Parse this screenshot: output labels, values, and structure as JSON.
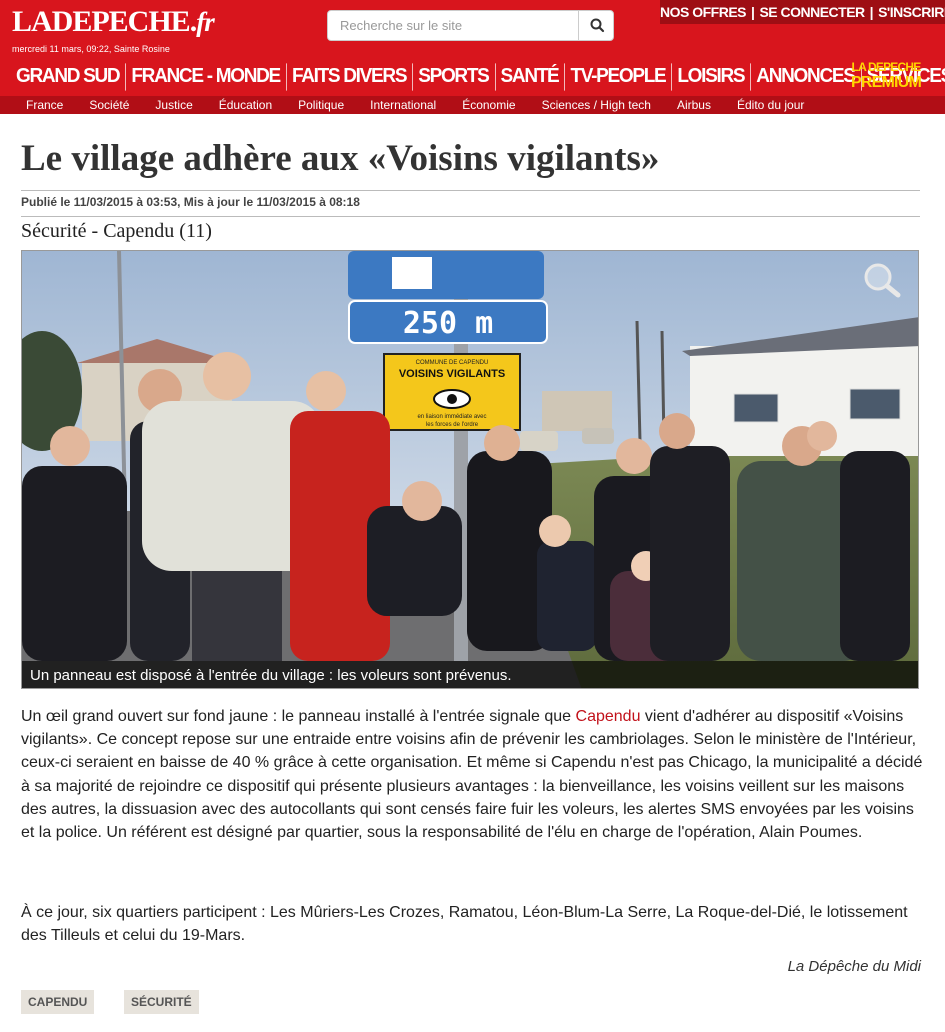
{
  "header": {
    "logo": {
      "main": "LADEPECHE",
      "dot": ".",
      "suffix": "fr"
    },
    "dateline": "mercredi 11 mars, 09:22, Sainte Rosine",
    "search": {
      "placeholder": "Recherche sur le site",
      "value": ""
    },
    "account": {
      "offers": "NOS OFFRES",
      "login": "SE CONNECTER",
      "signup": "S'INSCRIRE",
      "separator": "|"
    },
    "main_nav": [
      "GRAND SUD",
      "FRANCE - MONDE",
      "FAITS DIVERS",
      "SPORTS",
      "SANTÉ",
      "TV-PEOPLE",
      "LOISIRS",
      "ANNONCES",
      "SERVICES+"
    ],
    "premium": {
      "line1": "LA DEPECHE",
      "line2": "PREMIUM"
    },
    "sub_nav": [
      "France",
      "Société",
      "Justice",
      "Éducation",
      "Politique",
      "International",
      "Économie",
      "Sciences / High tech",
      "Airbus",
      "Édito du jour"
    ]
  },
  "article": {
    "title": "Le village adhère aux «Voisins vigilants»",
    "meta": "Publié le 11/03/2015 à 03:53, Mis à jour le 11/03/2015 à 08:18",
    "kicker": "Sécurité - Capendu (11)",
    "photo": {
      "caption": "Un panneau est disposé à l'entrée du village : les voleurs sont prévenus.",
      "sign_distance": "250 m",
      "sign_commune": "COMMUNE DE CAPENDU",
      "sign_title": "VOISINS VIGILANTS",
      "sign_sub1": "en liaison immédiate avec",
      "sign_sub2": "les forces de l'ordre"
    },
    "body": {
      "p1_before": "Un œil grand ouvert sur fond jaune : le panneau installé à l'entrée signale que ",
      "p1_link": "Capendu",
      "p1_after": " vient d'adhérer au dispositif «Voisins vigilants». Ce concept repose sur une entraide entre voisins afin de prévenir les cambriolages. Selon le ministère de l'Intérieur, ceux-ci seraient en baisse de 40 % grâce à cette organisation. Et même si Capendu n'est pas Chicago, la municipalité a décidé à sa majorité de rejoindre ce dispositif qui présente plusieurs avantages : la bienveillance, les voisins veillent sur les maisons des autres, la dissuasion avec des autocollants qui sont censés faire fuir les voleurs, les alertes SMS envoyées par les voisins et la police. Un référent est désigné par quartier, sous la responsabilité de l'élu en charge de l'opération, Alain Poumes.",
      "p2": "À ce jour, six quartiers participent : Les Mûriers-Les Crozes, Ramatou, Léon-Blum-La Serre, La Roque-del-Dié, le lotissement des Tilleuls et celui du 19-Mars."
    },
    "source": "La Dépêche du Midi",
    "tags": [
      "CAPENDU",
      "SÉCURITÉ"
    ]
  },
  "colors": {
    "brand_red": "#d8151d",
    "dark_red": "#9e0e14",
    "premium_yellow": "#ffd400",
    "link_red": "#c2121b"
  }
}
